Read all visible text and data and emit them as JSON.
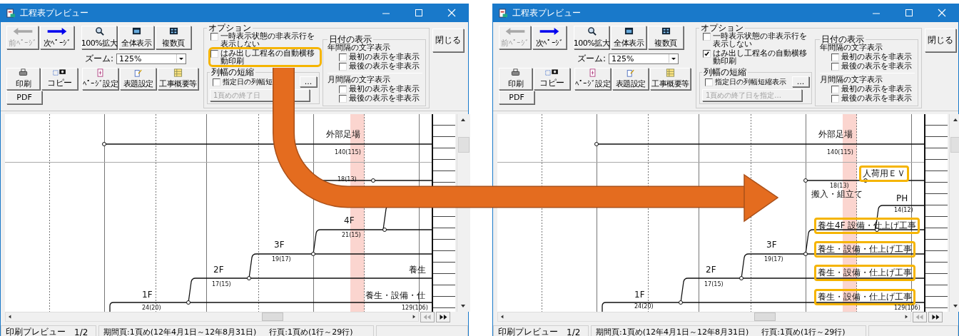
{
  "windows": [
    {
      "title": "工程表プレビュー",
      "nav_buttons": [
        {
          "label": "前ﾍﾟｰｼﾞ",
          "disabled": true
        },
        {
          "label": "次ﾍﾟｰｼﾞ",
          "disabled": false
        }
      ],
      "view_buttons": [
        "100%拡大",
        "全体表示",
        "複数頁"
      ],
      "zoom": {
        "label": "ズーム:",
        "value": "125%"
      },
      "action_buttons": [
        "印刷",
        "コピー",
        "ﾍﾟｰｼﾞ設定",
        "表題設定",
        "工事概要等"
      ],
      "pdf_button": "PDF",
      "options": {
        "title": "オプション",
        "checkboxes": [
          {
            "label": "一時表示状態の非表示行を表示しない",
            "checked": false,
            "highlighted": false
          },
          {
            "label": "はみ出し工程名の自動横移動印刷",
            "checked": false,
            "highlighted": true
          }
        ],
        "column_shrink": {
          "title": "列幅の短縮",
          "checkbox": {
            "label": "指定日の列幅短",
            "checked": false
          },
          "more_button": "...",
          "end_date_button": {
            "label": "1頁めの終了日",
            "disabled": true
          }
        }
      },
      "date_display": {
        "title": "日付の表示",
        "groups": [
          {
            "title": "年間隔の文字表示",
            "checkboxes": [
              {
                "label": "最初の表示を非表示",
                "checked": false
              },
              {
                "label": "最後の表示を非表示",
                "checked": false
              }
            ]
          },
          {
            "title": "月間隔の文字表示",
            "checkboxes": [
              {
                "label": "最初の表示を非表示",
                "checked": false
              },
              {
                "label": "最後の表示を非表示",
                "checked": false
              }
            ]
          }
        ]
      },
      "close_button": "閉じる",
      "chart_labels": [
        {
          "text": "外部足場",
          "kind": "name",
          "highlighted": false
        },
        {
          "text": "140(115)",
          "kind": "duration",
          "highlighted": false
        },
        {
          "text": "18(13)",
          "kind": "duration",
          "highlighted": false
        },
        {
          "text": "4F",
          "kind": "name",
          "highlighted": false
        },
        {
          "text": "21(15)",
          "kind": "duration",
          "highlighted": false
        },
        {
          "text": "3F",
          "kind": "name",
          "highlighted": false
        },
        {
          "text": "19(17)",
          "kind": "duration",
          "highlighted": false
        },
        {
          "text": "2F",
          "kind": "name",
          "highlighted": false
        },
        {
          "text": "17(15)",
          "kind": "duration",
          "highlighted": false
        },
        {
          "text": "1F",
          "kind": "name",
          "highlighted": false
        },
        {
          "text": "24(20)",
          "kind": "duration",
          "highlighted": false
        },
        {
          "text": "養生",
          "kind": "name",
          "highlighted": false
        },
        {
          "text": "養生・設備・仕",
          "kind": "name",
          "highlighted": false
        },
        {
          "text": "129(106)",
          "kind": "duration",
          "highlighted": false
        }
      ],
      "status_bar": {
        "mode": "印刷プレビュー",
        "page": "1/2",
        "period": "期間頁:1頁め(12年4月1日～12年8月31日)",
        "rows": "行頁:1頁め(1行～29行)"
      }
    },
    {
      "title": "工程表プレビュー",
      "nav_buttons": [
        {
          "label": "前ﾍﾟｰｼﾞ",
          "disabled": true
        },
        {
          "label": "次ﾍﾟｰｼﾞ",
          "disabled": false
        }
      ],
      "view_buttons": [
        "100%拡大",
        "全体表示",
        "複数頁"
      ],
      "zoom": {
        "label": "ズーム:",
        "value": "125%"
      },
      "action_buttons": [
        "印刷",
        "コピー",
        "ﾍﾟｰｼﾞ設定",
        "表題設定",
        "工事概要等"
      ],
      "pdf_button": "PDF",
      "options": {
        "title": "オプション",
        "checkboxes": [
          {
            "label": "一時表示状態の非表示行を表示しない",
            "checked": false,
            "highlighted": false
          },
          {
            "label": "はみ出し工程名の自動横移動印刷",
            "checked": true,
            "highlighted": false
          }
        ],
        "column_shrink": {
          "title": "列幅の短縮",
          "checkbox": {
            "label": "指定日の列幅短縮表示",
            "checked": false
          },
          "more_button": "...",
          "end_date_button": {
            "label": "1頁めの終了日を指定...",
            "disabled": true
          }
        }
      },
      "date_display": {
        "title": "日付の表示",
        "groups": [
          {
            "title": "年間隔の文字表示",
            "checkboxes": [
              {
                "label": "最初の表示を非表示",
                "checked": false
              },
              {
                "label": "最後の表示を非表示",
                "checked": false
              }
            ]
          },
          {
            "title": "月間隔の文字表示",
            "checkboxes": [
              {
                "label": "最初の表示を非表示",
                "checked": false
              },
              {
                "label": "最後の表示を非表示",
                "checked": false
              }
            ]
          }
        ]
      },
      "close_button": "閉じる",
      "chart_labels": [
        {
          "text": "外部足場",
          "kind": "name",
          "highlighted": false
        },
        {
          "text": "140(115)",
          "kind": "duration",
          "highlighted": false
        },
        {
          "text": "人荷用ＥＶ",
          "kind": "name",
          "highlighted": true
        },
        {
          "text": "18(13)",
          "kind": "duration",
          "highlighted": false
        },
        {
          "text": "搬入・組立て",
          "kind": "name",
          "highlighted": false
        },
        {
          "text": "PH",
          "kind": "name",
          "highlighted": false
        },
        {
          "text": "14(12)",
          "kind": "duration",
          "highlighted": false
        },
        {
          "text": "養生4F 設備・仕上げ工事",
          "kind": "name",
          "highlighted": true
        },
        {
          "text": "3F",
          "kind": "name",
          "highlighted": false
        },
        {
          "text": "19(17)",
          "kind": "duration",
          "highlighted": false
        },
        {
          "text": "養生・設備・仕上げ工事",
          "kind": "name",
          "highlighted": true
        },
        {
          "text": "2F",
          "kind": "name",
          "highlighted": false
        },
        {
          "text": "17(15)",
          "kind": "duration",
          "highlighted": false
        },
        {
          "text": "養生・設備・仕上げ工事",
          "kind": "name",
          "highlighted": true
        },
        {
          "text": "1F",
          "kind": "name",
          "highlighted": false
        },
        {
          "text": "24(20)",
          "kind": "duration",
          "highlighted": false
        },
        {
          "text": "養生・設備・仕上げ工事",
          "kind": "name",
          "highlighted": true
        },
        {
          "text": "129(106)",
          "kind": "duration",
          "highlighted": false
        }
      ],
      "status_bar": {
        "mode": "印刷プレビュー",
        "page": "1/2",
        "period": "期間頁:1頁め(12年4月1日～12年8月31日)",
        "rows": "行頁:1頁め(1行～29行)"
      }
    }
  ]
}
